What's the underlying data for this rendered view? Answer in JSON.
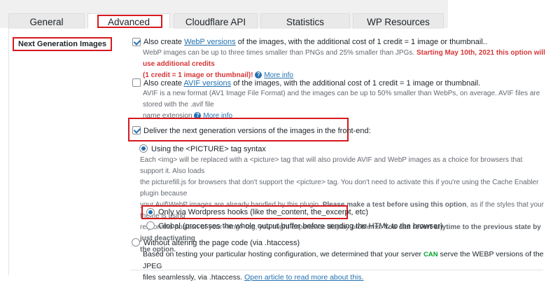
{
  "tabs": [
    {
      "label": "General"
    },
    {
      "label": "Advanced"
    },
    {
      "label": "Cloudflare API"
    },
    {
      "label": "Statistics"
    },
    {
      "label": "WP Resources"
    }
  ],
  "section": {
    "label": "Next Generation Images"
  },
  "webp": {
    "checked": true,
    "pre": "Also create ",
    "link": "WebP versions",
    "post": " of the images, with the additional cost of 1 credit = 1 image or thumbnail..",
    "desc_line1_a": "WebP images can be up to three times smaller than PNGs and 25% smaller than JPGs. ",
    "desc_line1_warn": "Starting May 10th, 2021 this option will use additional credits",
    "desc_line2_warn": "(1 credit = 1 image or thumbnail)!",
    "more": "More info"
  },
  "avif": {
    "checked": false,
    "pre": "Also create ",
    "link": "AVIF versions",
    "post": " of the images, with the additional cost of 1 credit = 1 image or thumbnail.",
    "desc_line1": "AVIF is a new format (AV1 Image File Format) and the images can be up to 50% smaller than WebPs, on average. AVIF files are stored with the .avif file",
    "desc_line2": "name extension ",
    "more": "More info"
  },
  "deliver": {
    "checked": true,
    "label": "Deliver the next generation versions of the images in the front-end:"
  },
  "picture": {
    "checked": true,
    "label": "Using the <PICTURE> tag syntax",
    "desc1": "Each <img> will be replaced with a <picture> tag that will also provide AVIF and WebP images as a choice for browsers that support it. Also loads",
    "desc2": "the picturefill.js for browsers that don't support the <picture> tag. You don't need to activate this if you're using the Cache Enabler plugin because",
    "desc3_a": "your Avif\\WebP images are already handled by this plugin. ",
    "desc3_b": "Please make a test before using this option",
    "desc3_c": ", as if the styles that your theme is using",
    "desc4_a": "rely on the position of your <img> tag, you might experience display problems. ",
    "desc4_b": "You can revert anytime to the previous state by just deactivating",
    "desc5_b": "the option."
  },
  "hooks": {
    "checked": true,
    "label": "Only via Wordpress hooks (like the_content, the_excerpt, etc)"
  },
  "global": {
    "checked": false,
    "label": "Global (processes the whole output buffer before sending the HTML to the browser)"
  },
  "htaccess": {
    "checked": false,
    "label": "Without altering the page code (via .htaccess)",
    "desc1_a": "Based on testing your particular hosting configuration, we determined that your server ",
    "can": "CAN",
    "desc1_c": " serve the WEBP versions of the JPEG",
    "desc2_a": "files seamlessly, via .htaccess. ",
    "desc2_link": "Open article to read more about this."
  },
  "colors": {
    "highlight": "#d6191f",
    "link": "#2271b1",
    "warning": "#d63638",
    "can": "#00a32a"
  }
}
